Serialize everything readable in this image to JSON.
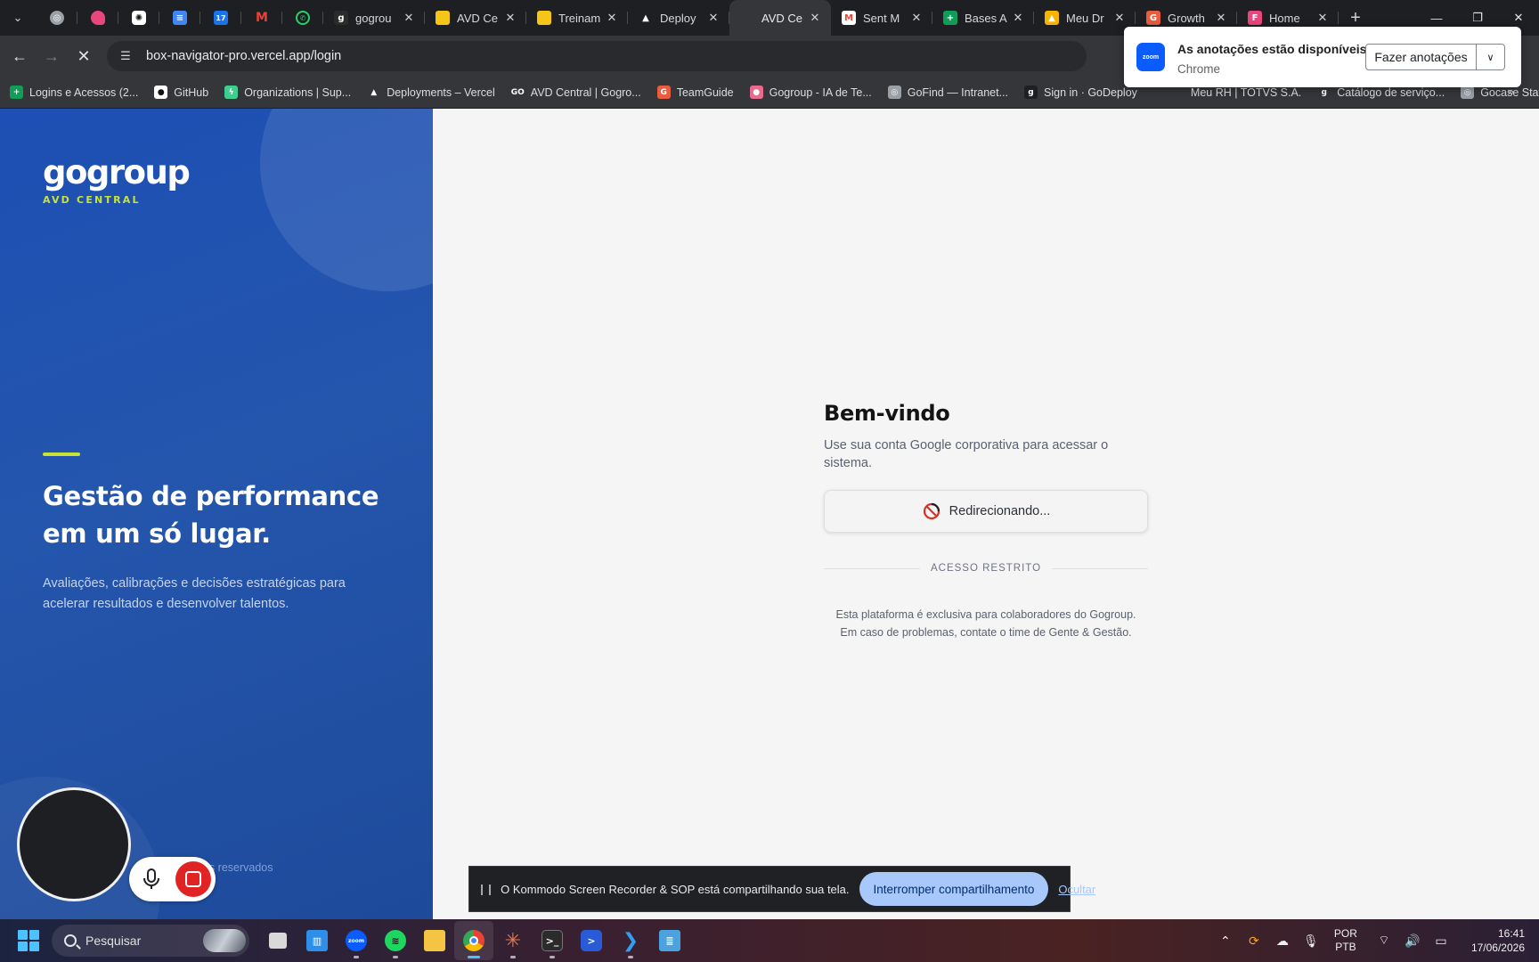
{
  "tabs": [
    {
      "label": "gogrou",
      "favicon_color": "#2b2b2b",
      "glyph": "g"
    },
    {
      "label": "AVD Ce",
      "favicon_color": "#f5c518",
      "glyph": ""
    },
    {
      "label": "Treinam",
      "favicon_color": "#f5c518",
      "glyph": ""
    },
    {
      "label": "Deploy",
      "favicon_color": "#1e1f22",
      "glyph": "▲"
    },
    {
      "label": "AVD Ce",
      "favicon_color": "#35363a",
      "glyph": ""
    },
    {
      "label": "Sent M",
      "favicon_color": "#ffffff",
      "glyph": "M"
    },
    {
      "label": "Bases A",
      "favicon_color": "#0f9d58",
      "glyph": "+"
    },
    {
      "label": "Meu Dr",
      "favicon_color": "#f4b400",
      "glyph": "▲"
    },
    {
      "label": "Growth",
      "favicon_color": "#e85d3f",
      "glyph": "G"
    },
    {
      "label": "Home",
      "favicon_color": "#e8467c",
      "glyph": "F"
    }
  ],
  "address": {
    "url": "box-navigator-pro.vercel.app/login"
  },
  "bookmarks": [
    {
      "label": "Logins e Acessos (2...",
      "color": "#0f9d58",
      "glyph": "+"
    },
    {
      "label": "GitHub",
      "color": "#ffffff",
      "glyph": "●"
    },
    {
      "label": "Organizations | Sup...",
      "color": "#3ecf8e",
      "glyph": "ϟ"
    },
    {
      "label": "Deployments – Vercel",
      "color": "#35363a",
      "glyph": "▲"
    },
    {
      "label": "AVD Central | Gogro...",
      "color": "#35363a",
      "glyph": "GO"
    },
    {
      "label": "TeamGuide",
      "color": "#e85d3f",
      "glyph": "G"
    },
    {
      "label": "Gogroup - IA de Te...",
      "color": "#e86a8f",
      "glyph": "●"
    },
    {
      "label": "GoFind — Intranet...",
      "color": "#9aa0a6",
      "glyph": "◎"
    },
    {
      "label": "Sign in · GoDeploy",
      "color": "#1e1f22",
      "glyph": "g"
    },
    {
      "label": "Meu RH | TOTVS S.A.",
      "color": "#35363a",
      "glyph": ""
    },
    {
      "label": "Catálogo de serviço...",
      "color": "#35363a",
      "glyph": "g"
    },
    {
      "label": "Gocase Staff",
      "color": "#9aa0a6",
      "glyph": "◎"
    }
  ],
  "hero": {
    "logo": "gogroup",
    "logo_sub": "AVD CENTRAL",
    "headline": "Gestão de performance em um só lugar.",
    "description": "Avaliações, calibrações e decisões estratégicas para acelerar resultados e desenvolver talentos.",
    "footer": "os reservados"
  },
  "login": {
    "title": "Bem-vindo",
    "subtitle": "Use sua conta Google corporativa para acessar o sistema.",
    "button_label": "Redirecionando...",
    "divider": "ACESSO RESTRITO",
    "note_line1": "Esta plataforma é exclusiva para colaboradores do Gogroup.",
    "note_line2": "Em caso de problemas, contate o time de Gente & Gestão."
  },
  "notification": {
    "app_icon_text": "zoom",
    "title": "As anotações estão disponíveis",
    "source": "Chrome",
    "action": "Fazer anotações"
  },
  "sharebar": {
    "text": "O Kommodo Screen Recorder & SOP está compartilhando sua tela.",
    "stop": "Interromper compartilhamento",
    "hide": "Ocultar"
  },
  "taskbar": {
    "search_placeholder": "Pesquisar",
    "lang_top": "POR",
    "lang_bottom": "PTB",
    "time": "16:41",
    "date": "17/06/2026"
  },
  "colors": {
    "hero_blue": "#1d4fb4",
    "accent_lime": "#c8e334",
    "zoom_blue": "#0b5cff",
    "share_button": "#a8c7fa"
  }
}
